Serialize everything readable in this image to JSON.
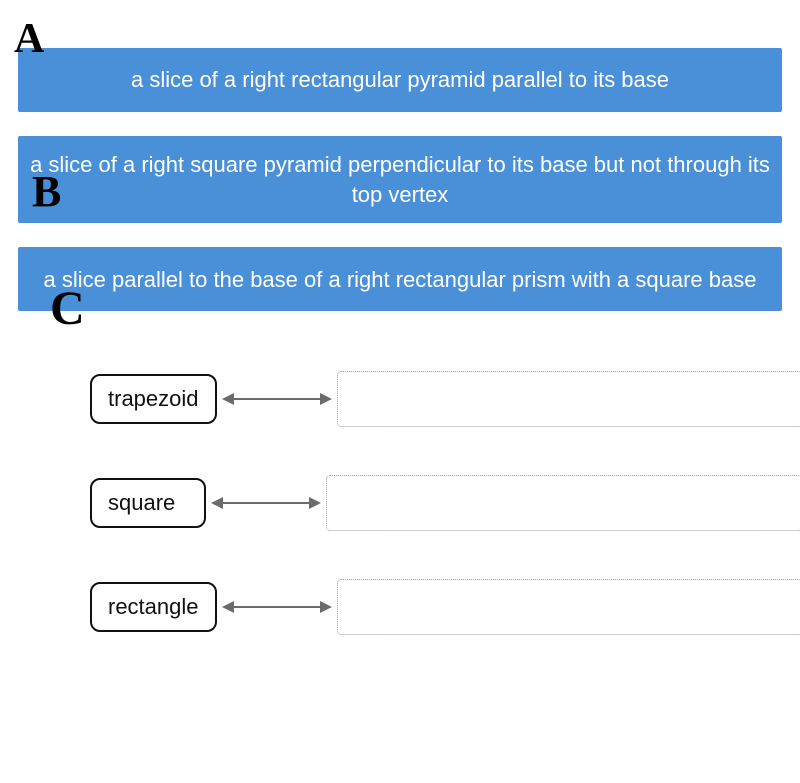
{
  "colors": {
    "prompt_bg": "#4a90d9",
    "prompt_fg": "#ffffff",
    "chip_border": "#111111",
    "arrow": "#6b6b6b",
    "dotted": "#9aa0a6"
  },
  "prompts": [
    {
      "hand_label": "A",
      "text": "a slice of a right rectangular pyramid parallel to its base"
    },
    {
      "hand_label": "B",
      "text": "a slice of a right square pyramid perpendicular to its base but not through its top vertex"
    },
    {
      "hand_label": "C",
      "text": "a slice parallel to the base of a right rectangular prism with a square base"
    }
  ],
  "answers": [
    {
      "label": "trapezoid"
    },
    {
      "label": "square"
    },
    {
      "label": "rectangle"
    }
  ]
}
